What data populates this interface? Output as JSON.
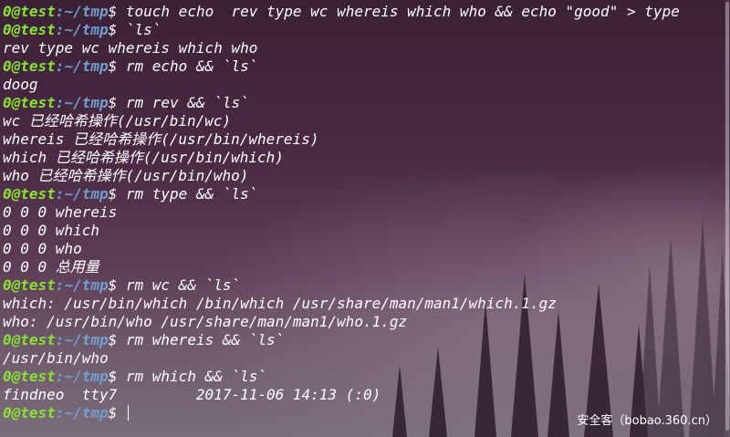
{
  "prompt": {
    "user": "0@test",
    "sep": ":",
    "path": "~/tmp",
    "symbol": "$"
  },
  "lines": [
    {
      "type": "cmd",
      "text": " touch echo  rev type wc whereis which who && echo \"good\" > type"
    },
    {
      "type": "cmd",
      "text": " `ls`"
    },
    {
      "type": "out",
      "text": "rev type wc whereis which who"
    },
    {
      "type": "cmd",
      "text": " rm echo && `ls`"
    },
    {
      "type": "out",
      "text": "doog"
    },
    {
      "type": "cmd",
      "text": " rm rev && `ls`"
    },
    {
      "type": "out",
      "text": "wc 已经哈希操作(/usr/bin/wc)"
    },
    {
      "type": "out",
      "text": "whereis 已经哈希操作(/usr/bin/whereis)"
    },
    {
      "type": "out",
      "text": "which 已经哈希操作(/usr/bin/which)"
    },
    {
      "type": "out",
      "text": "who 已经哈希操作(/usr/bin/who)"
    },
    {
      "type": "cmd",
      "text": " rm type && `ls`"
    },
    {
      "type": "out",
      "text": "0 0 0 whereis"
    },
    {
      "type": "out",
      "text": "0 0 0 which"
    },
    {
      "type": "out",
      "text": "0 0 0 who"
    },
    {
      "type": "out",
      "text": "0 0 0 总用量"
    },
    {
      "type": "cmd",
      "text": " rm wc && `ls`"
    },
    {
      "type": "out",
      "text": "which: /usr/bin/which /bin/which /usr/share/man/man1/which.1.gz"
    },
    {
      "type": "out",
      "text": "who: /usr/bin/who /usr/share/man/man1/who.1.gz"
    },
    {
      "type": "cmd",
      "text": " rm whereis && `ls`"
    },
    {
      "type": "out",
      "text": "/usr/bin/who"
    },
    {
      "type": "cmd",
      "text": " rm which && `ls`"
    },
    {
      "type": "out",
      "text": "findneo  tty7         2017-11-06 14:13 (:0)"
    },
    {
      "type": "cmd",
      "text": " ",
      "cursor": true
    }
  ],
  "watermark": "安全客（bobao.360.cn）",
  "colors": {
    "user": "#8ae234",
    "path": "#729fcf",
    "text": "#ffffff"
  }
}
